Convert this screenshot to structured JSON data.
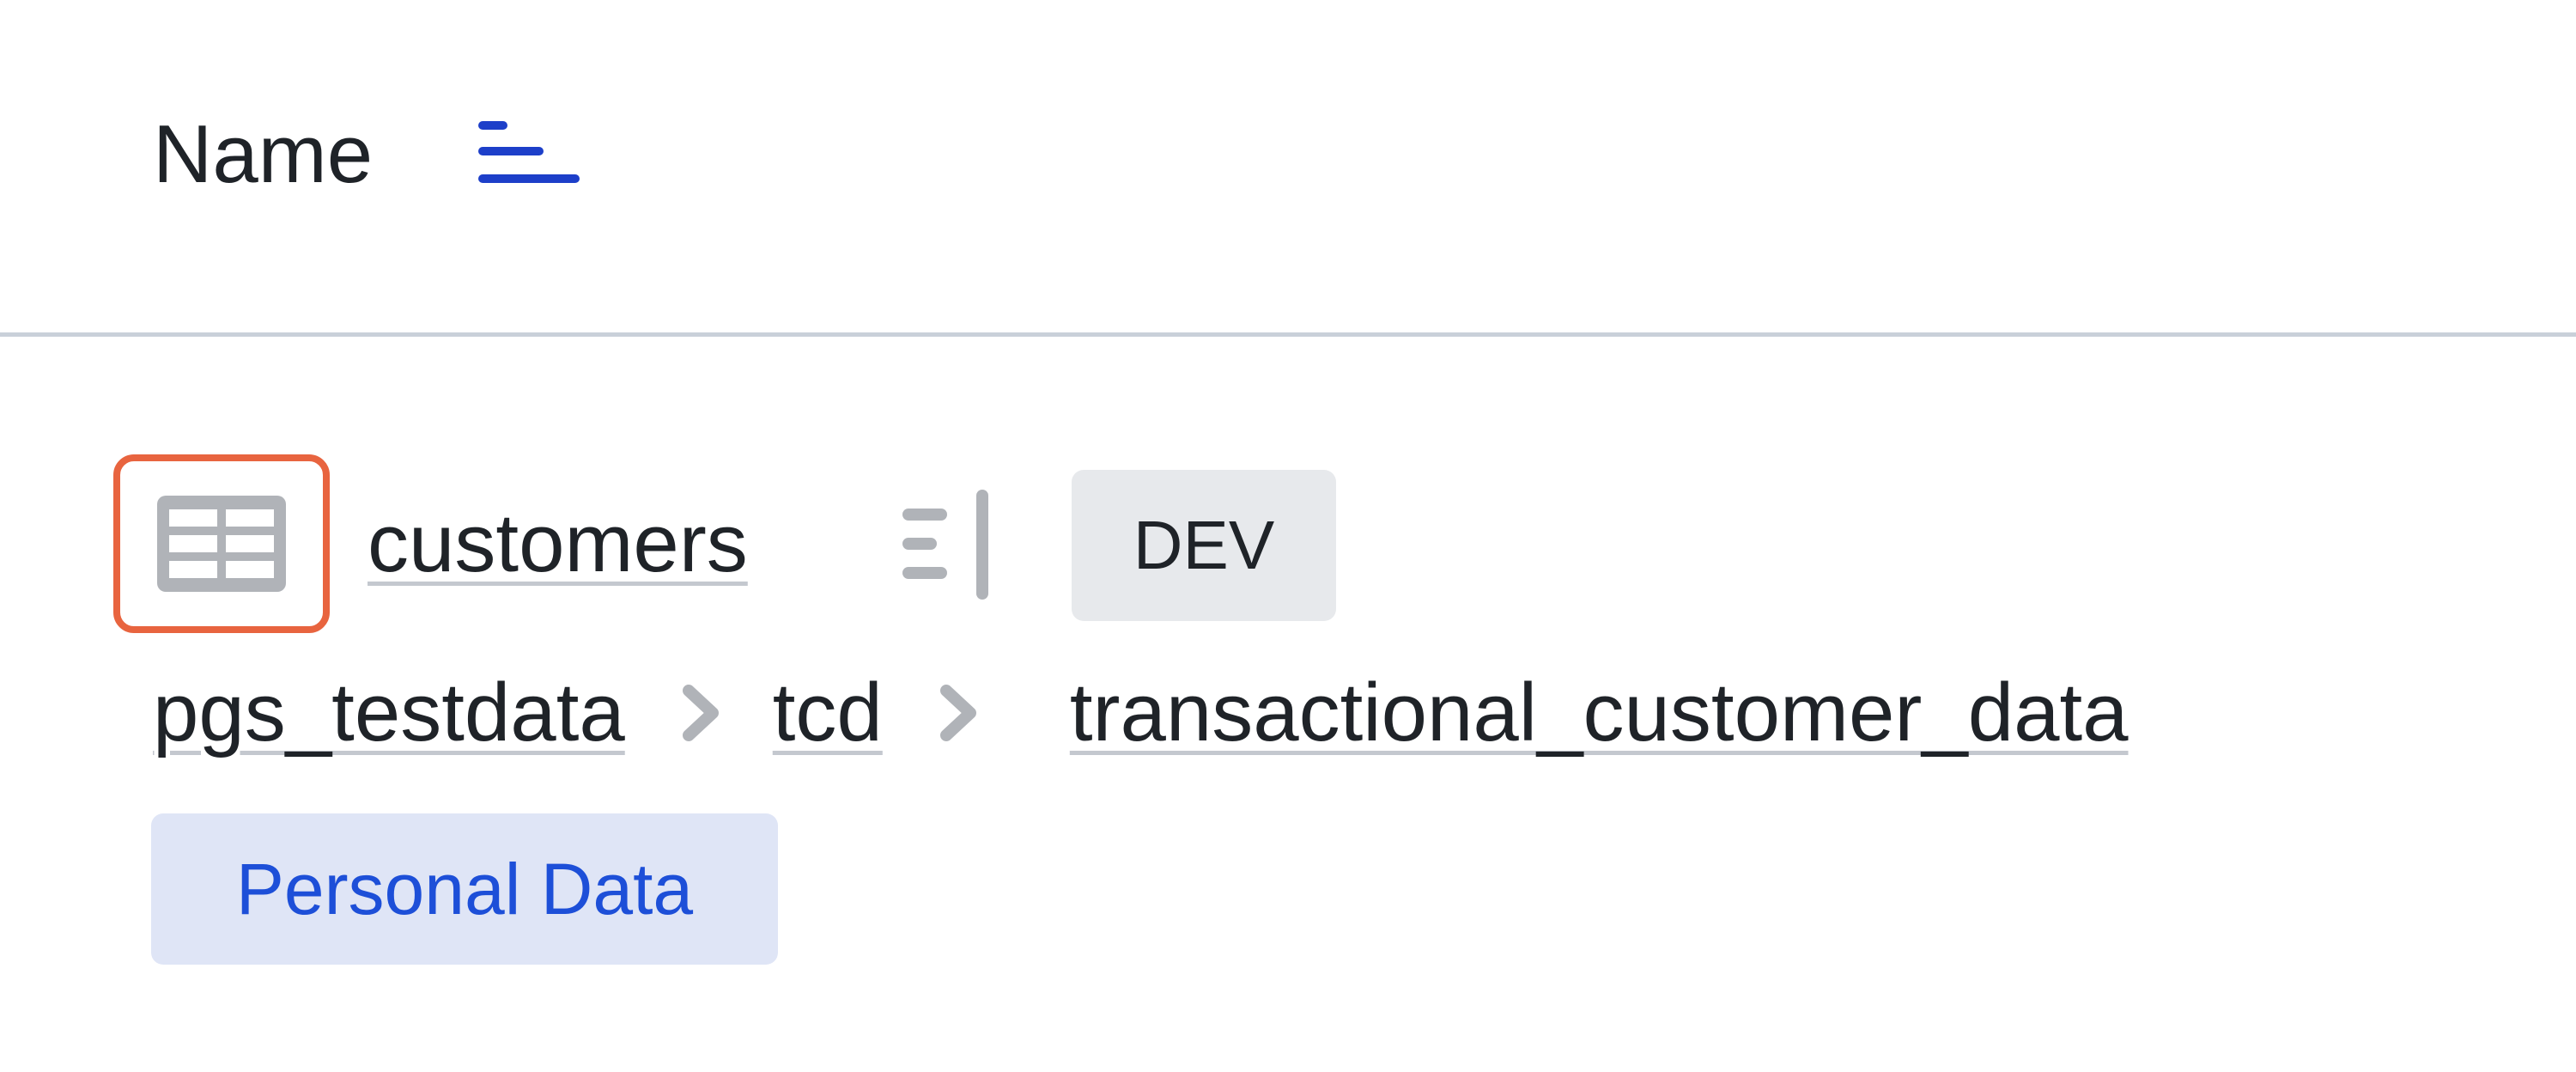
{
  "header": {
    "title": "Name",
    "sort_icon": "sort-descending-icon",
    "accent_color": "#1d3fc9"
  },
  "row": {
    "type_icon": "table-icon",
    "name": "customers",
    "sidebar_icon": "open-sidebar-icon",
    "environment_badge": "DEV",
    "breadcrumb": [
      "pgs_testdata",
      "tcd",
      "transactional_customer_data"
    ],
    "breadcrumb_separator_icon": "chevron-right-icon",
    "tag": "Personal Data"
  },
  "colors": {
    "highlight_border": "#e8643f",
    "tag_background": "#dfe5f6",
    "tag_text": "#1d4fd8",
    "badge_background": "#e7e9ec",
    "divider": "#c9d0d9"
  }
}
